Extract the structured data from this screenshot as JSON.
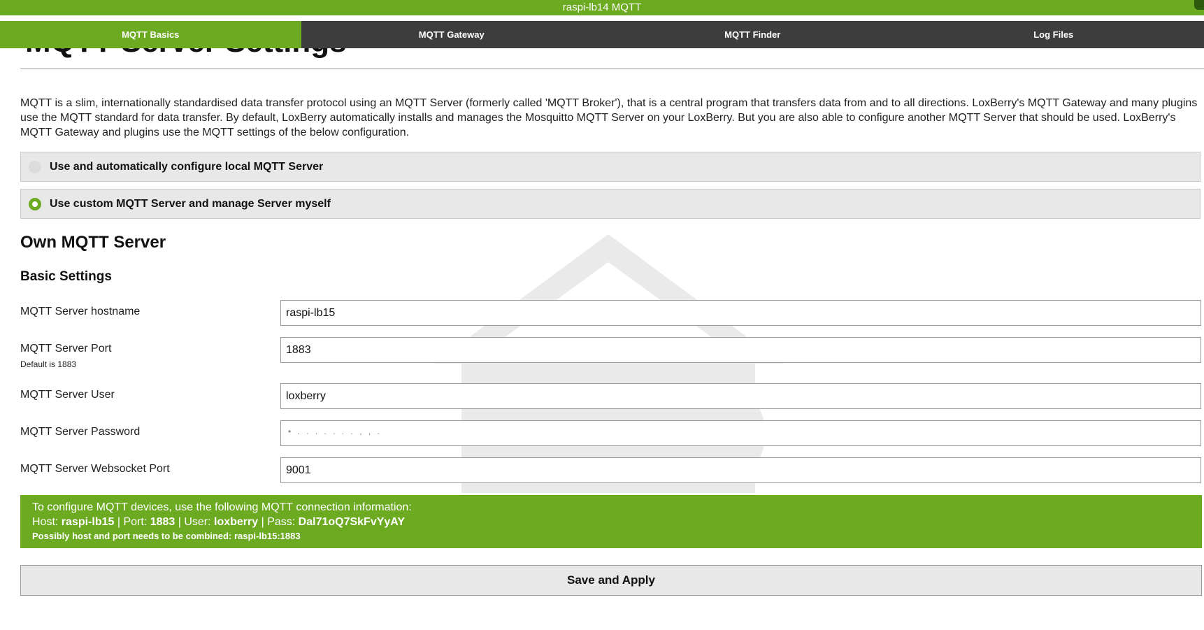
{
  "window": {
    "title": "raspi-lb14 MQTT"
  },
  "nav": {
    "tabs": [
      {
        "label": "MQTT Basics",
        "active": true
      },
      {
        "label": "MQTT Gateway",
        "active": false
      },
      {
        "label": "MQTT Finder",
        "active": false
      },
      {
        "label": "Log Files",
        "active": false
      }
    ]
  },
  "page": {
    "title": "MQTT Server Settings",
    "intro": "MQTT is a slim, internationally standardised data transfer protocol using an MQTT Server (formerly called 'MQTT Broker'), that is a central program that transfers data from and to all directions. LoxBerry's MQTT Gateway and many plugins use the MQTT standard for data transfer. By default, LoxBerry automatically installs and manages the Mosquitto MQTT Server on your LoxBerry. But you are also able to configure another MQTT Server that should be used. LoxBerry's MQTT Gateway and plugins use the MQTT settings of the below configuration."
  },
  "server_mode": {
    "options": [
      {
        "label": "Use and automatically configure local MQTT Server",
        "selected": false
      },
      {
        "label": "Use custom MQTT Server and manage Server myself",
        "selected": true
      }
    ]
  },
  "own_server": {
    "heading": "Own MQTT Server",
    "basic_heading": "Basic Settings",
    "fields": {
      "hostname": {
        "label": "MQTT Server hostname",
        "value": "raspi-lb15"
      },
      "port": {
        "label": "MQTT Server Port",
        "hint": "Default is 1883",
        "value": "1883"
      },
      "user": {
        "label": "MQTT Server User",
        "value": "loxberry"
      },
      "password": {
        "label": "MQTT Server Password",
        "value": "",
        "mask": "• .  .  .  .  .  .  .  ,  ,  ."
      },
      "websocket_port": {
        "label": "MQTT Server Websocket Port",
        "value": "9001"
      }
    }
  },
  "connection_info": {
    "line1": "To configure MQTT devices, use the following MQTT connection information:",
    "host_label": "Host:",
    "host": "raspi-lb15",
    "port_label": "Port:",
    "port": "1883",
    "user_label": "User:",
    "user": "loxberry",
    "pass_label": "Pass:",
    "pass": "Dal71oQ7SkFvYyAY",
    "combined_label": "Possibly host and port needs to be combined:",
    "combined": "raspi-lb15:1883"
  },
  "actions": {
    "save_label": "Save and Apply"
  },
  "colors": {
    "accent": "#6caa21",
    "nav_bg": "#3d3d3d"
  }
}
